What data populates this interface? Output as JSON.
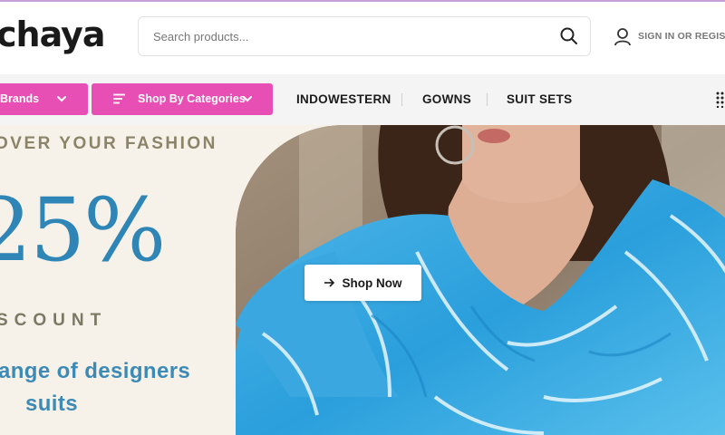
{
  "header": {
    "logo": "chaya",
    "search_placeholder": "Search products...",
    "signin": "SIGN IN OR REGISTER"
  },
  "nav": {
    "brands_label": "Brands",
    "categories_label": "Shop By Categories",
    "links": [
      "INDOWESTERN",
      "GOWNS",
      "SUIT SETS"
    ]
  },
  "hero": {
    "eyebrow": "OVER YOUR FASHION",
    "discount_value": "25%",
    "discount_word": "SCOUNT",
    "tagline_line1": "ange of designers",
    "tagline_line2": "suits",
    "cta_label": "Shop Now"
  },
  "colors": {
    "accent_pink": "#e84fb4",
    "headline_blue": "#2f86b6",
    "hero_bg": "#f6f2ea"
  }
}
